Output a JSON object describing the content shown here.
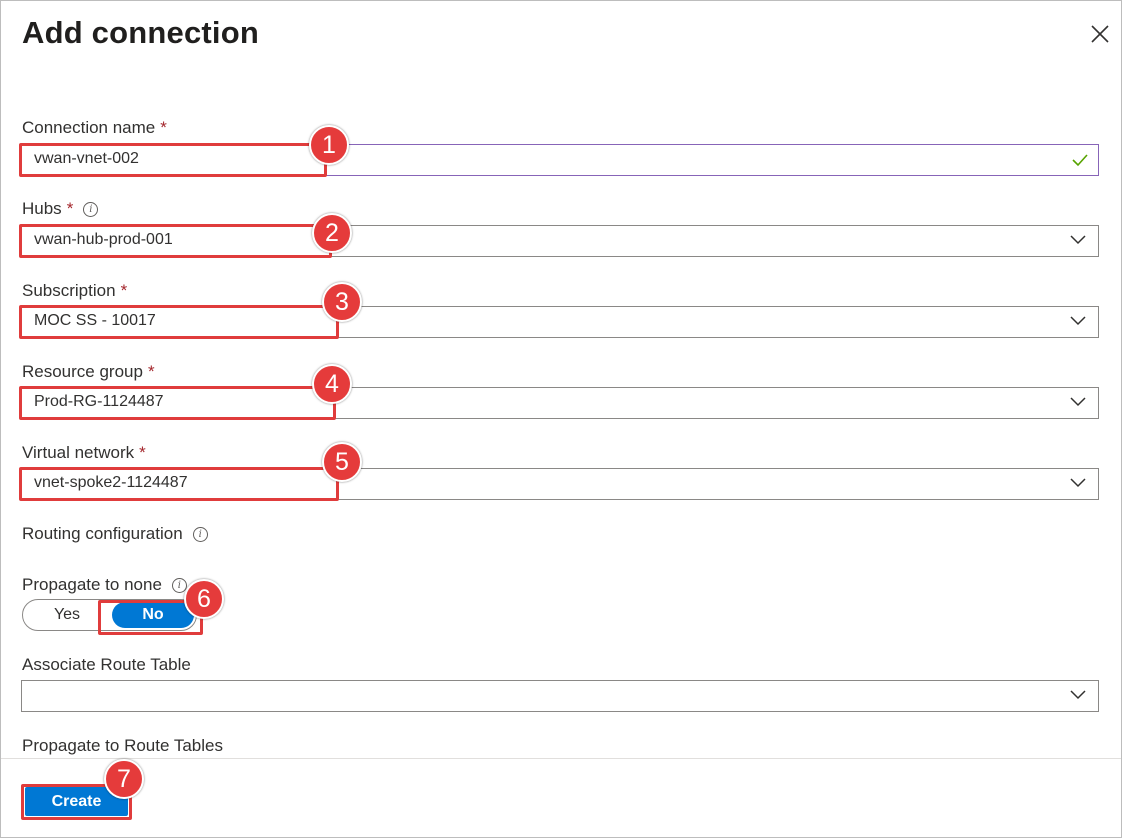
{
  "panel": {
    "title": "Add connection"
  },
  "form": {
    "connection_name": {
      "label": "Connection name",
      "value": "vwan-vnet-002"
    },
    "hubs": {
      "label": "Hubs",
      "value": "vwan-hub-prod-001"
    },
    "subscription": {
      "label": "Subscription",
      "value": "MOC SS - 10017"
    },
    "resource_group": {
      "label": "Resource group",
      "value": "Prod-RG-1124487"
    },
    "virtual_network": {
      "label": "Virtual network",
      "value": "vnet-spoke2-1124487"
    },
    "routing_configuration": {
      "label": "Routing configuration"
    },
    "propagate_to_none": {
      "label": "Propagate to none",
      "yes": "Yes",
      "no": "No",
      "selected": "No"
    },
    "associate_route_table": {
      "label": "Associate Route Table",
      "value": ""
    },
    "propagate_to_route_tables": {
      "label": "Propagate to Route Tables"
    },
    "required_mark": "*",
    "info_glyph": "i"
  },
  "footer": {
    "create_label": "Create"
  },
  "callouts": [
    "1",
    "2",
    "3",
    "4",
    "5",
    "6",
    "7"
  ],
  "colors": {
    "accent": "#0078d4",
    "highlight": "#e03c3c",
    "required": "#a4262c",
    "valid_border": "#8764b8",
    "check": "#57a300"
  }
}
